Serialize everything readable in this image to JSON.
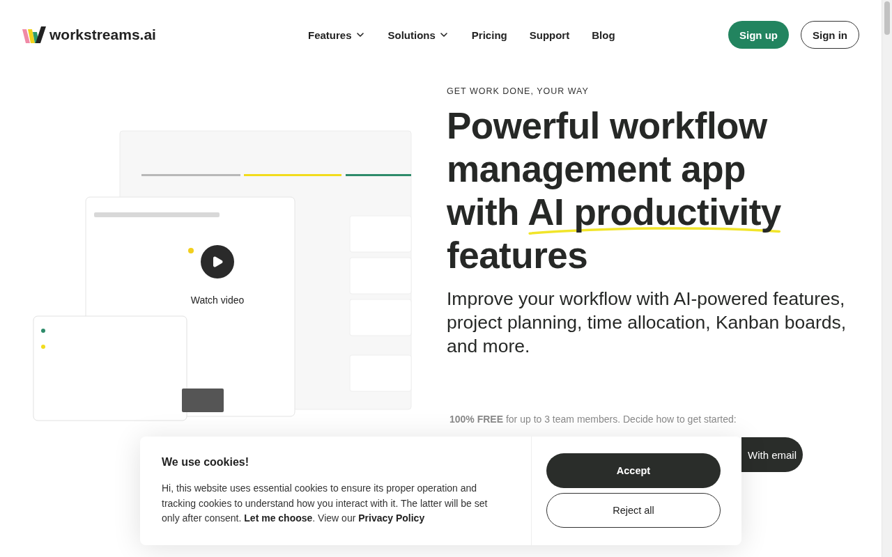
{
  "header": {
    "logo": "workstreams.ai",
    "nav": [
      {
        "label": "Features",
        "dropdown": true
      },
      {
        "label": "Solutions",
        "dropdown": true
      },
      {
        "label": "Pricing",
        "dropdown": false
      },
      {
        "label": "Support",
        "dropdown": false
      },
      {
        "label": "Blog",
        "dropdown": false
      }
    ],
    "signup": "Sign up",
    "signin": "Sign in"
  },
  "video": {
    "label": "Watch video"
  },
  "hero": {
    "eyebrow": "GET WORK DONE, YOUR WAY",
    "headline": [
      {
        "text": "Powerful workflow"
      },
      {
        "text": "management app"
      },
      {
        "text": "with ",
        "highlight": "AI productivity"
      },
      {
        "text": "features"
      }
    ],
    "subhead": "Improve your workflow with AI-powered features, project planning, time allocation, Kanban boards, and more.",
    "free": "**100% FREE** for up to 3 team members.  Decide how to get started:",
    "email_button": "With email"
  },
  "cookies": {
    "title": "We use cookies!",
    "segments": [
      {
        "kind": "text",
        "text": "Hi, this website uses essential cookies to ensure its proper operation and tracking cookies to understand how you interact with it. The latter will be set only after consent. "
      },
      {
        "kind": "link",
        "text": "Let me choose"
      },
      {
        "kind": "text",
        "text": ". View our "
      },
      {
        "kind": "link",
        "text": "Privacy Policy"
      }
    ],
    "accept": "Accept",
    "reject": "Reject all"
  }
}
